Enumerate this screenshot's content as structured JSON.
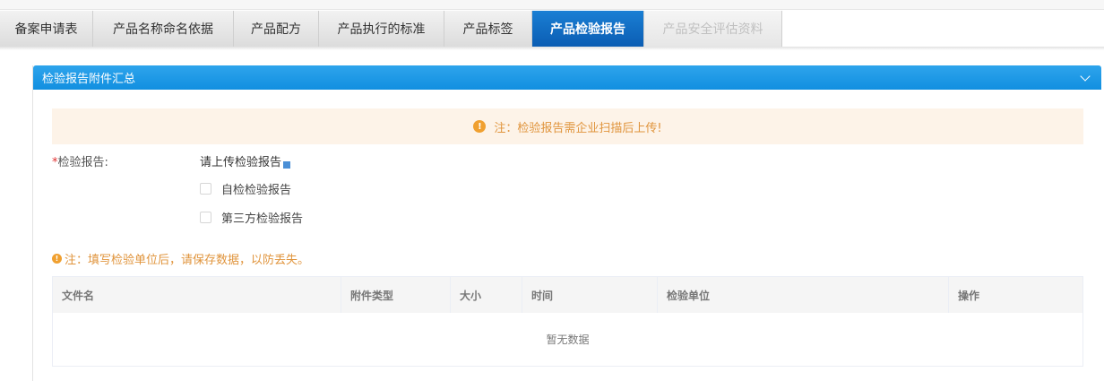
{
  "tabs": [
    {
      "label": "备案申请表",
      "state": "normal"
    },
    {
      "label": "产品名称命名依据",
      "state": "normal"
    },
    {
      "label": "产品配方",
      "state": "normal"
    },
    {
      "label": "产品执行的标准",
      "state": "normal"
    },
    {
      "label": "产品标签",
      "state": "normal"
    },
    {
      "label": "产品检验报告",
      "state": "active"
    },
    {
      "label": "产品安全评估资料",
      "state": "disabled"
    }
  ],
  "panel": {
    "title": "检验报告附件汇总",
    "notice": "注：检验报告需企业扫描后上传!",
    "field_required_mark": "*",
    "field_label": "检验报告:",
    "upload_hint": "请上传检验报告",
    "options": [
      "自检检验报告",
      "第三方检验报告"
    ],
    "save_note": "注：填写检验单位后，请保存数据，以防丢失。"
  },
  "table": {
    "columns": [
      "文件名",
      "附件类型",
      "大小",
      "时间",
      "检验单位",
      "操作"
    ],
    "empty_text": "暂无数据"
  },
  "colors": {
    "active_tab": "#0b5db3",
    "panel_header": "#1a96e4",
    "notice_text": "#e0943c",
    "notice_bg": "#fdf3e8"
  }
}
